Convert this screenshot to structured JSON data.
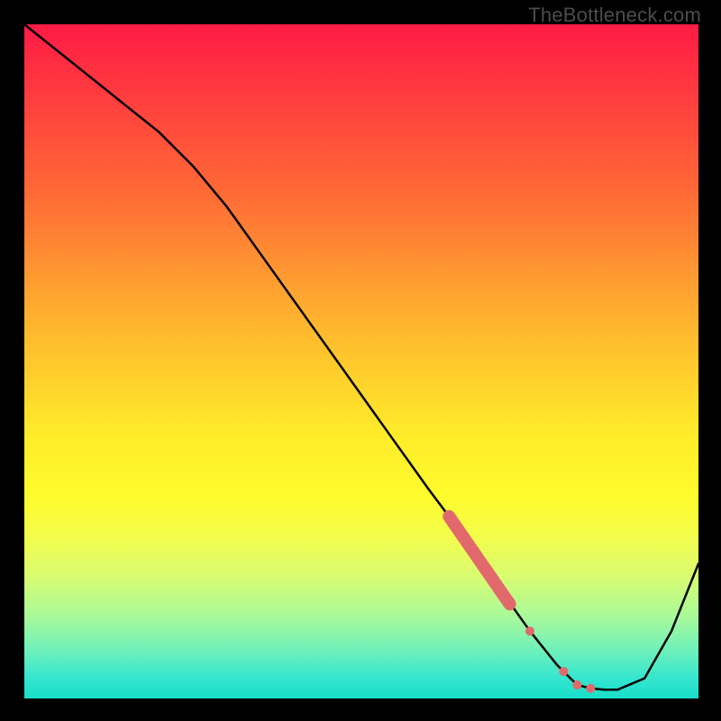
{
  "watermark": "TheBottleneck.com",
  "chart_data": {
    "type": "line",
    "title": "",
    "xlabel": "",
    "ylabel": "",
    "xlim": [
      0,
      100
    ],
    "ylim": [
      0,
      100
    ],
    "grid": false,
    "series": [
      {
        "name": "bottleneck-curve",
        "x": [
          0,
          5,
          10,
          15,
          20,
          25,
          30,
          35,
          40,
          45,
          50,
          55,
          60,
          63,
          65,
          70,
          75,
          79,
          80,
          81,
          82,
          84,
          86,
          88,
          92,
          96,
          100
        ],
        "values": [
          100,
          96,
          92,
          88,
          84,
          79,
          73,
          66,
          59,
          52,
          45,
          38,
          31,
          27,
          24,
          17,
          10,
          5,
          4,
          3,
          2,
          1.5,
          1.3,
          1.3,
          3,
          10,
          20
        ]
      }
    ],
    "markers": [
      {
        "name": "highlight-band",
        "shape": "thick-segment",
        "x": [
          63,
          72
        ],
        "y": [
          27,
          14
        ],
        "color": "#e2696b",
        "width": 14
      },
      {
        "name": "dot-1",
        "shape": "circle",
        "x": 75,
        "y": 10,
        "r": 5,
        "color": "#e2696b"
      },
      {
        "name": "dot-2",
        "shape": "circle",
        "x": 80,
        "y": 4,
        "r": 5,
        "color": "#e2696b"
      },
      {
        "name": "dot-3",
        "shape": "circle",
        "x": 82,
        "y": 2,
        "r": 5,
        "color": "#e2696b"
      },
      {
        "name": "dot-4",
        "shape": "circle",
        "x": 84,
        "y": 1.5,
        "r": 5,
        "color": "#e2696b"
      }
    ]
  }
}
